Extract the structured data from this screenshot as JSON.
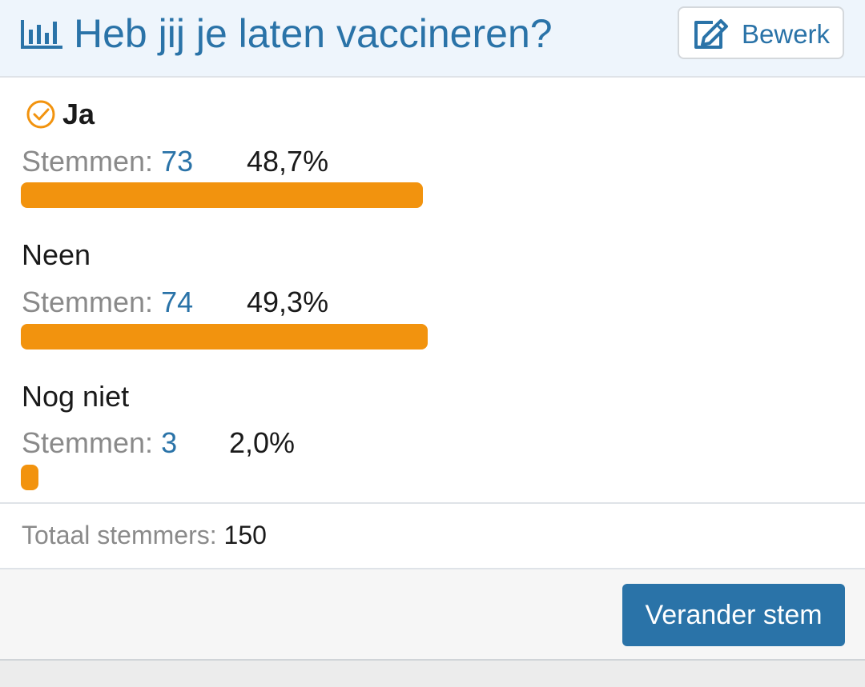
{
  "header": {
    "icon": "bar-chart-icon",
    "title": "Heb jij je laten vaccineren?",
    "edit_button": {
      "icon": "edit-icon",
      "label": "Bewerk"
    }
  },
  "colors": {
    "accent": "#2a73a8",
    "bar": "#f2930e",
    "selected_check": "#f2930e"
  },
  "options": [
    {
      "label": "Ja",
      "selected": true,
      "votes_prefix": "Stemmen:",
      "votes": "73",
      "percent": "48,7%",
      "share": 0.487
    },
    {
      "label": "Neen",
      "selected": false,
      "votes_prefix": "Stemmen:",
      "votes": "74",
      "percent": "49,3%",
      "share": 0.493
    },
    {
      "label": "Nog niet",
      "selected": false,
      "votes_prefix": "Stemmen:",
      "votes": "3",
      "percent": "2,0%",
      "share": 0.02
    }
  ],
  "total": {
    "prefix": "Totaal stemmers:",
    "count": "150"
  },
  "footer": {
    "change_vote_label": "Verander stem"
  }
}
